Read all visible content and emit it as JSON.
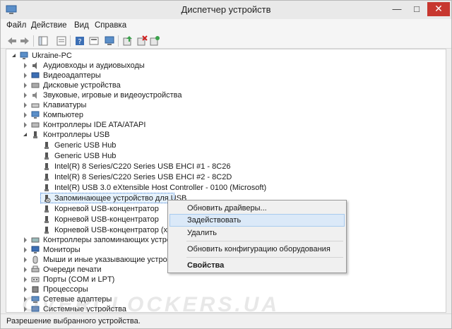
{
  "window": {
    "title": "Диспетчер устройств",
    "min_glyph": "—",
    "max_glyph": "□",
    "close_glyph": "✕"
  },
  "menu": {
    "file": "Файл",
    "action": "Действие",
    "view": "Вид",
    "help": "Справка"
  },
  "toolbar": [
    "back-icon",
    "forward-icon",
    "console-tree-icon",
    "properties-icon",
    "help-icon",
    "show-hidden-icon",
    "computer-icon",
    "update-driver-icon",
    "disable-device-icon",
    "scan-hardware-icon"
  ],
  "tree": {
    "root": "Ukraine-PC",
    "categories": {
      "audio": "Аудиовходы и аудиовыходы",
      "video": "Видеоадаптеры",
      "disks": "Дисковые устройства",
      "sound": "Звуковые, игровые и видеоустройства",
      "keyboards": "Клавиатуры",
      "computer": "Компьютер",
      "ide": "Контроллеры IDE ATA/ATAPI",
      "usb": "Контроллеры USB"
    },
    "usb_children": {
      "c0": "Generic USB Hub",
      "c1": "Generic USB Hub",
      "c2": "Intel(R) 8 Series/C220 Series USB EHCI #1 - 8C26",
      "c3": "Intel(R) 8 Series/C220 Series USB EHCI #2 - 8C2D",
      "c4": "Intel(R) USB 3.0 eXtensible Host Controller - 0100 (Microsoft)",
      "c5": "Запоминающее устройство для USB",
      "c6": "Корневой USB-концентратор",
      "c7": "Корневой USB-концентратор",
      "c8": "Корневой USB-концентратор (xHCI)"
    },
    "after": {
      "storage": "Контроллеры запоминающих устройств",
      "monitors": "Мониторы",
      "mice": "Мыши и иные указывающие устройства",
      "print": "Очереди печати",
      "ports": "Порты (COM и LPT)",
      "cpu": "Процессоры",
      "net": "Сетевые адаптеры",
      "system": "Системные устройства"
    }
  },
  "context_menu": {
    "update": "Обновить драйверы...",
    "enable": "Задействовать",
    "delete": "Удалить",
    "scan": "Обновить конфигурацию оборудования",
    "props": "Свойства"
  },
  "status": "Разрешение выбранного устройства.",
  "watermark": "OVERCLOCKERS.UA",
  "colors": {
    "accent": "#3f7fd5",
    "close": "#c7372f"
  }
}
